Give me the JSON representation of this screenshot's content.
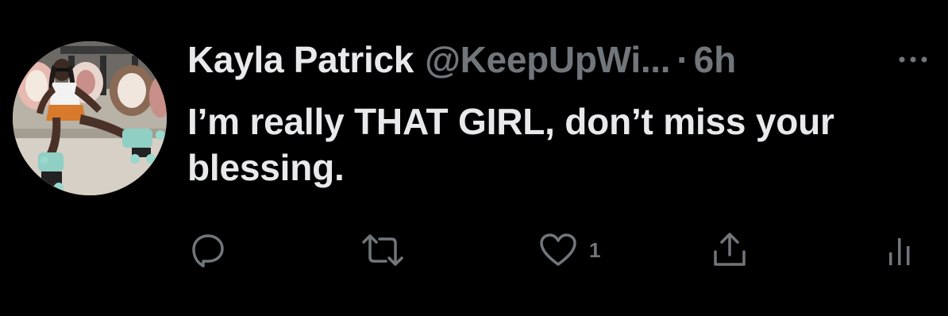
{
  "tweet": {
    "display_name": "Kayla Patrick",
    "handle": "@KeepUpWi...",
    "separator": "·",
    "time": "6h",
    "text": "I’m really THAT GIRL, don’t miss your blessing.",
    "more_icon": "more-horizontal-icon",
    "avatar_description": "profile photo"
  },
  "actions": {
    "reply": {
      "icon": "reply-icon",
      "count": ""
    },
    "retweet": {
      "icon": "retweet-icon",
      "count": ""
    },
    "like": {
      "icon": "heart-icon",
      "count": "1"
    },
    "share": {
      "icon": "share-icon",
      "count": ""
    },
    "analytics": {
      "icon": "analytics-icon",
      "count": ""
    }
  },
  "colors": {
    "background": "#000000",
    "primary_text": "#e7e9ea",
    "secondary_text": "#71767b"
  }
}
